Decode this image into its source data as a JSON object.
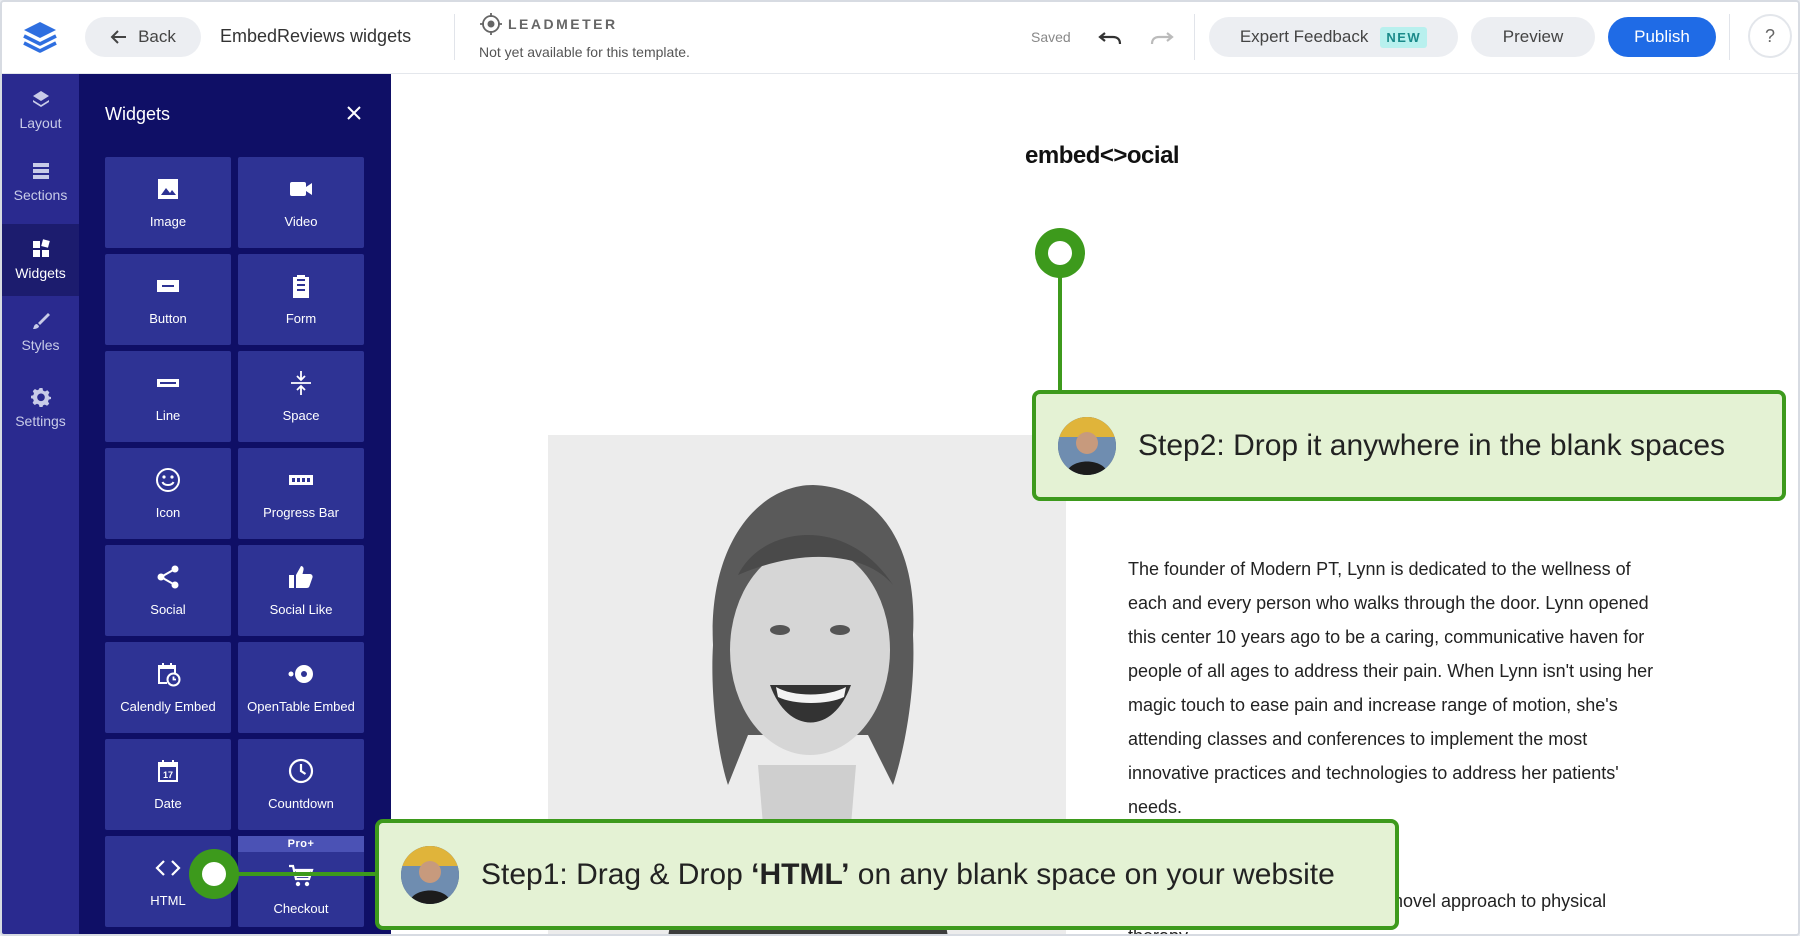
{
  "header": {
    "back_label": "Back",
    "doc_title": "EmbedReviews widgets",
    "leadmeter_label": "LEADMETER",
    "leadmeter_status": "Not yet available for this template.",
    "saved_label": "Saved",
    "expert_label": "Expert Feedback",
    "new_badge": "NEW",
    "preview_label": "Preview",
    "publish_label": "Publish",
    "help_label": "?"
  },
  "rail": {
    "items": [
      {
        "label": "Layout",
        "icon": "layers-icon"
      },
      {
        "label": "Sections",
        "icon": "sections-icon"
      },
      {
        "label": "Widgets",
        "icon": "widgets-icon",
        "active": true
      },
      {
        "label": "Styles",
        "icon": "brush-icon"
      },
      {
        "label": "Settings",
        "icon": "gear-icon"
      }
    ]
  },
  "panel": {
    "title": "Widgets",
    "widgets": [
      {
        "label": "Image",
        "icon": "image-icon"
      },
      {
        "label": "Video",
        "icon": "video-icon"
      },
      {
        "label": "Button",
        "icon": "button-icon"
      },
      {
        "label": "Form",
        "icon": "clipboard-icon"
      },
      {
        "label": "Line",
        "icon": "line-icon"
      },
      {
        "label": "Space",
        "icon": "space-icon"
      },
      {
        "label": "Icon",
        "icon": "smiley-icon"
      },
      {
        "label": "Progress Bar",
        "icon": "battery-icon"
      },
      {
        "label": "Social",
        "icon": "share-icon"
      },
      {
        "label": "Social Like",
        "icon": "thumbs-up-icon"
      },
      {
        "label": "Calendly Embed",
        "icon": "calendar-clock-icon"
      },
      {
        "label": "OpenTable Embed",
        "icon": "opentable-icon"
      },
      {
        "label": "Date",
        "icon": "calendar-icon"
      },
      {
        "label": "Countdown",
        "icon": "clock-icon"
      },
      {
        "label": "HTML",
        "icon": "code-icon"
      },
      {
        "label": "Checkout",
        "icon": "cart-icon",
        "tag": "Pro+"
      }
    ]
  },
  "canvas": {
    "site_logo": "embed<>ocial",
    "bio_text": "The founder of Modern PT, Lynn is dedicated to the wellness of each and every person who walks through the door. Lynn opened this center 10 years ago to be a caring, communicative haven for people of all ages to address their pain. When Lynn isn't using her magic touch to ease pain and increase range of motion, she's attending classes and conferences to implement the most innovative practices and technologies to address her patients' needs.",
    "bio_partial": "novel approach to physical",
    "bio_tail": "therapy."
  },
  "annotations": {
    "step1_prefix": "Step1: Drag & Drop ",
    "step1_bold": "‘HTML’",
    "step1_suffix": " on any blank space on your website",
    "step2": "Step2: Drop it anywhere in the blank spaces"
  },
  "colors": {
    "accent_blue": "#1f6be6",
    "rail_bg": "#2a2a8f",
    "panel_bg": "#0f0f66",
    "tile_bg": "#2e3394",
    "callout_green": "#3d9a1c",
    "callout_fill": "#e4f2d4"
  }
}
